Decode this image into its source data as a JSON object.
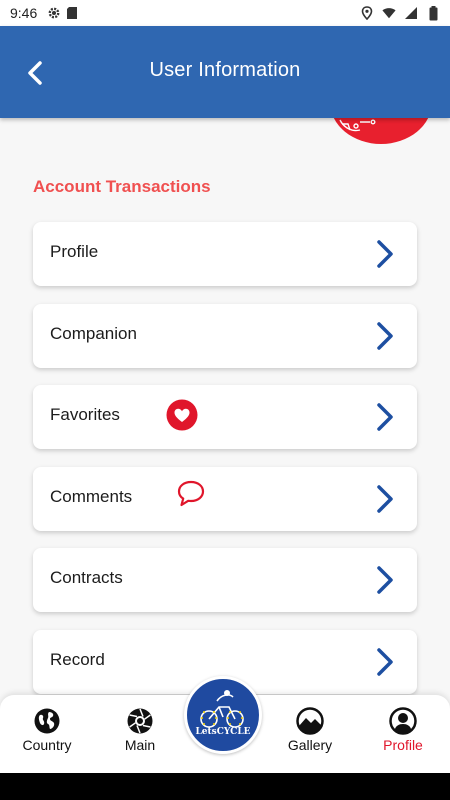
{
  "status_bar": {
    "time": "9:46",
    "left_icons": [
      "gear-icon",
      "sd-card-icon"
    ],
    "right_icons": [
      "location-icon",
      "wifi-icon",
      "signal-icon",
      "battery-icon"
    ]
  },
  "app_bar": {
    "title": "User Information",
    "back_icon": "chevron-left-icon",
    "background_color": "#2f67b1"
  },
  "section": {
    "title": "Account Transactions",
    "title_color": "#f05050"
  },
  "menu_items": [
    {
      "label": "Profile",
      "icon": null
    },
    {
      "label": "Companion",
      "icon": null
    },
    {
      "label": "Favorites",
      "icon": "heart-icon"
    },
    {
      "label": "Comments",
      "icon": "comment-icon"
    },
    {
      "label": "Contracts",
      "icon": null
    },
    {
      "label": "Record",
      "icon": null
    }
  ],
  "bottom_nav": {
    "items": [
      {
        "label": "Country",
        "icon": "globe-icon",
        "active": false
      },
      {
        "label": "Main",
        "icon": "aperture-icon",
        "active": false
      },
      {
        "label": "Gallery",
        "icon": "landscape-icon",
        "active": false
      },
      {
        "label": "Profile",
        "icon": "user-icon",
        "active": true
      }
    ],
    "center_logo_text": "LetsCYCLE",
    "active_color": "#e0162b"
  }
}
